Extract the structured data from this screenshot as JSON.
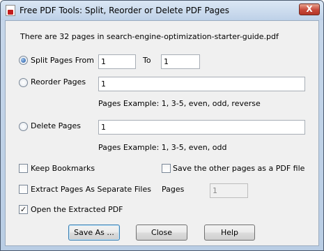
{
  "window": {
    "title": "Free PDF Tools: Split, Reorder or Delete PDF Pages",
    "close_glyph": "X"
  },
  "info_text": "There are 32 pages in search-engine-optimization-starter-guide.pdf",
  "split": {
    "label": "Split Pages From",
    "selected": true,
    "from_value": "1",
    "to_label": "To",
    "to_value": "1"
  },
  "reorder": {
    "label": "Reorder Pages",
    "selected": false,
    "value": "1",
    "example": "Pages Example: 1, 3-5, even, odd, reverse"
  },
  "delete": {
    "label": "Delete Pages",
    "selected": false,
    "value": "1",
    "example": "Pages Example: 1, 3-5, even, odd"
  },
  "options": {
    "keep_bookmarks": {
      "label": "Keep Bookmarks",
      "checked": false
    },
    "save_other_pages": {
      "label": "Save the other pages as a PDF file",
      "checked": false
    },
    "extract_separate": {
      "label": "Extract Pages As Separate Files",
      "checked": false
    },
    "pages_label": "Pages",
    "pages_value": "1",
    "open_extracted": {
      "label": "Open the Extracted PDF",
      "checked": true
    }
  },
  "buttons": {
    "save_as": "Save As ...",
    "close": "Close",
    "help": "Help"
  }
}
